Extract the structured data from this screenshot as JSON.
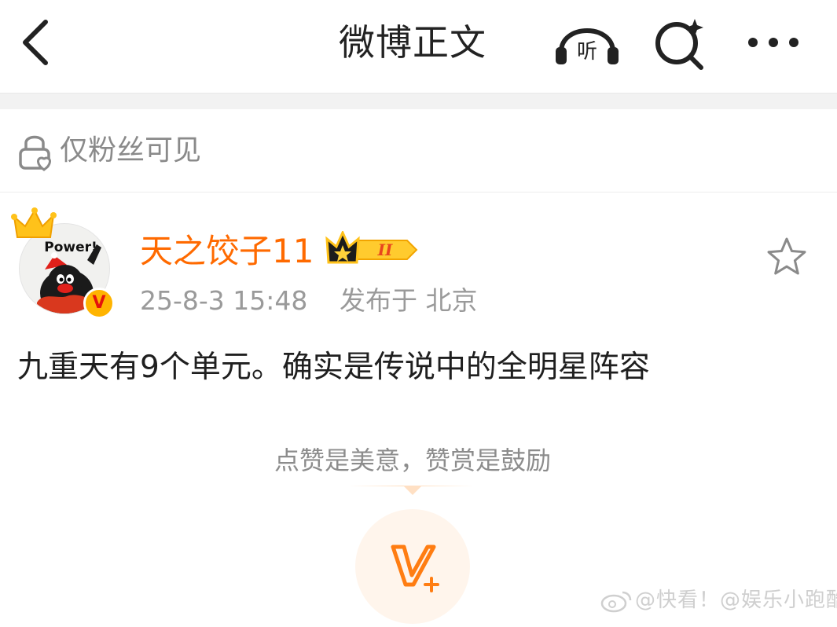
{
  "nav": {
    "title": "微博正文",
    "listen_label": "听"
  },
  "visibility": {
    "text": "仅粉丝可见"
  },
  "author": {
    "name": "天之饺子11",
    "avatar_text": "Power!",
    "verified_mark": "V",
    "member_level": "II"
  },
  "meta": {
    "time": "25-8-3 15:48",
    "location": "发布于 北京"
  },
  "post": {
    "text": "九重天有9个单元。确实是传说中的全明星阵容"
  },
  "reward": {
    "hint": "点赞是美意，赞赏是鼓励",
    "button_label": "V+"
  },
  "watermark": {
    "text": "@快看！@娱乐小跑酷"
  },
  "colors": {
    "accent_orange": "#ff6a00",
    "meta_gray": "#9a9a9a",
    "badge_gold": "#ffb400"
  },
  "icons": {
    "back": "chevron-left-icon",
    "listen": "headphones-icon",
    "search": "search-sparkle-icon",
    "more": "more-dots-icon",
    "lock": "lock-heart-icon",
    "favorite": "star-outline-icon"
  }
}
